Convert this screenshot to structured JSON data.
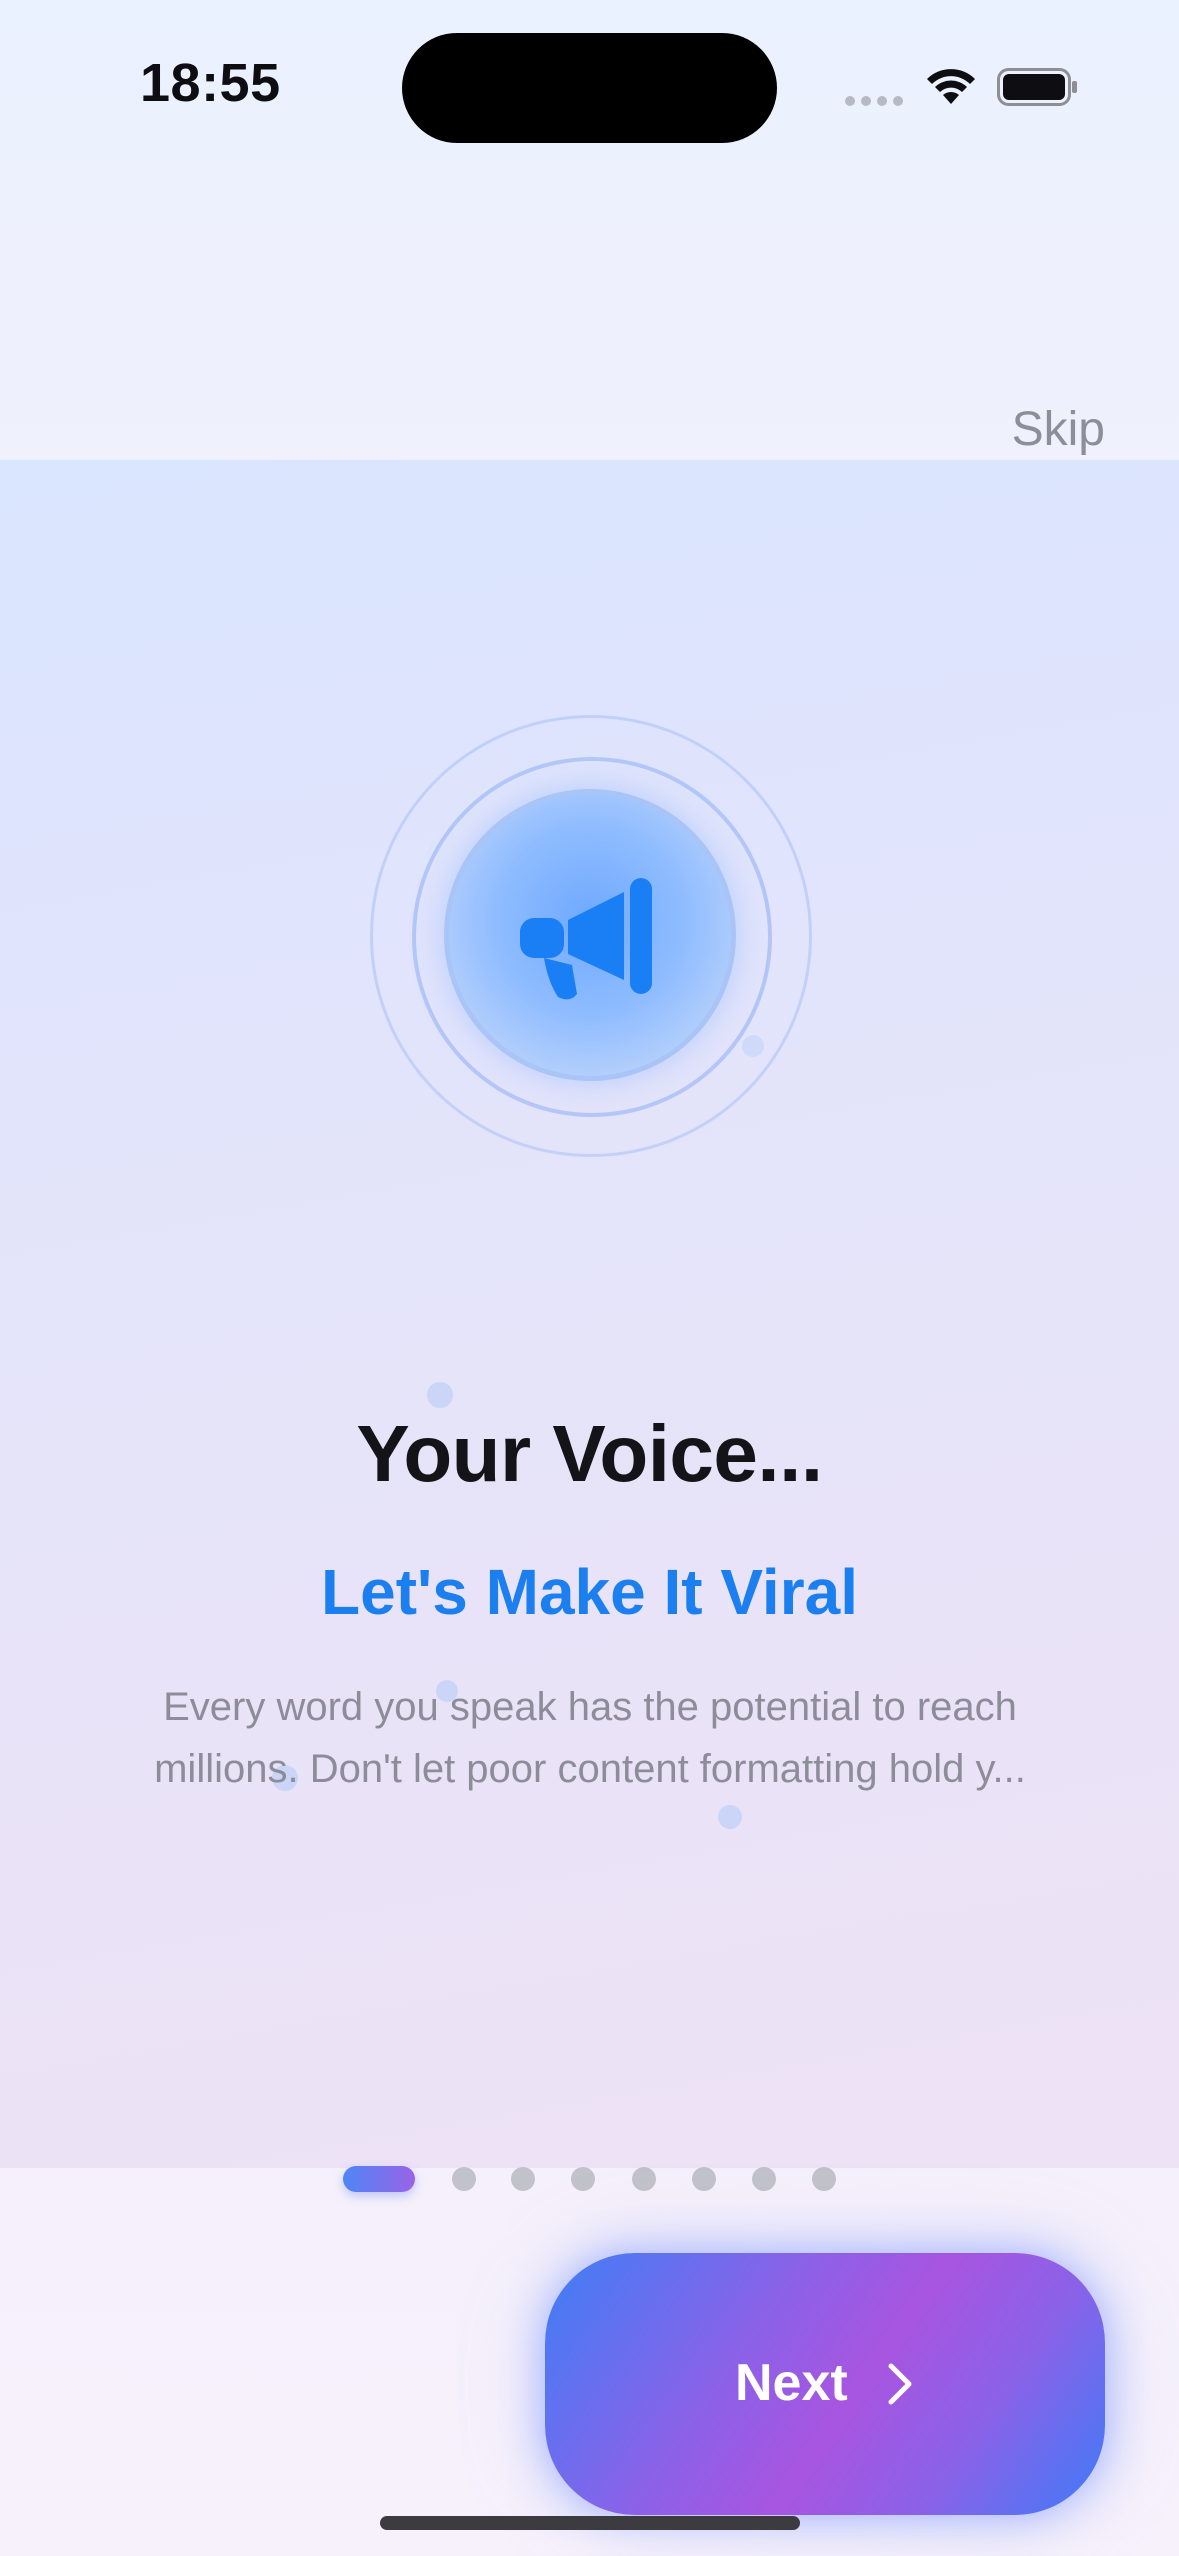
{
  "status_bar": {
    "time": "18:55"
  },
  "top_bar": {
    "skip_label": "Skip"
  },
  "hero": {
    "icon": "megaphone-icon",
    "accent_color": "#1b7ff0"
  },
  "content": {
    "headline": "Your Voice...",
    "subheadline": "Let's Make It Viral",
    "description": "Every word you speak has the potential to reach millions. Don't let poor content formatting hold y..."
  },
  "pagination": {
    "total_pages": 8,
    "current_page": 1
  },
  "footer": {
    "next_label": "Next",
    "next_icon": "chevron-right-icon"
  }
}
